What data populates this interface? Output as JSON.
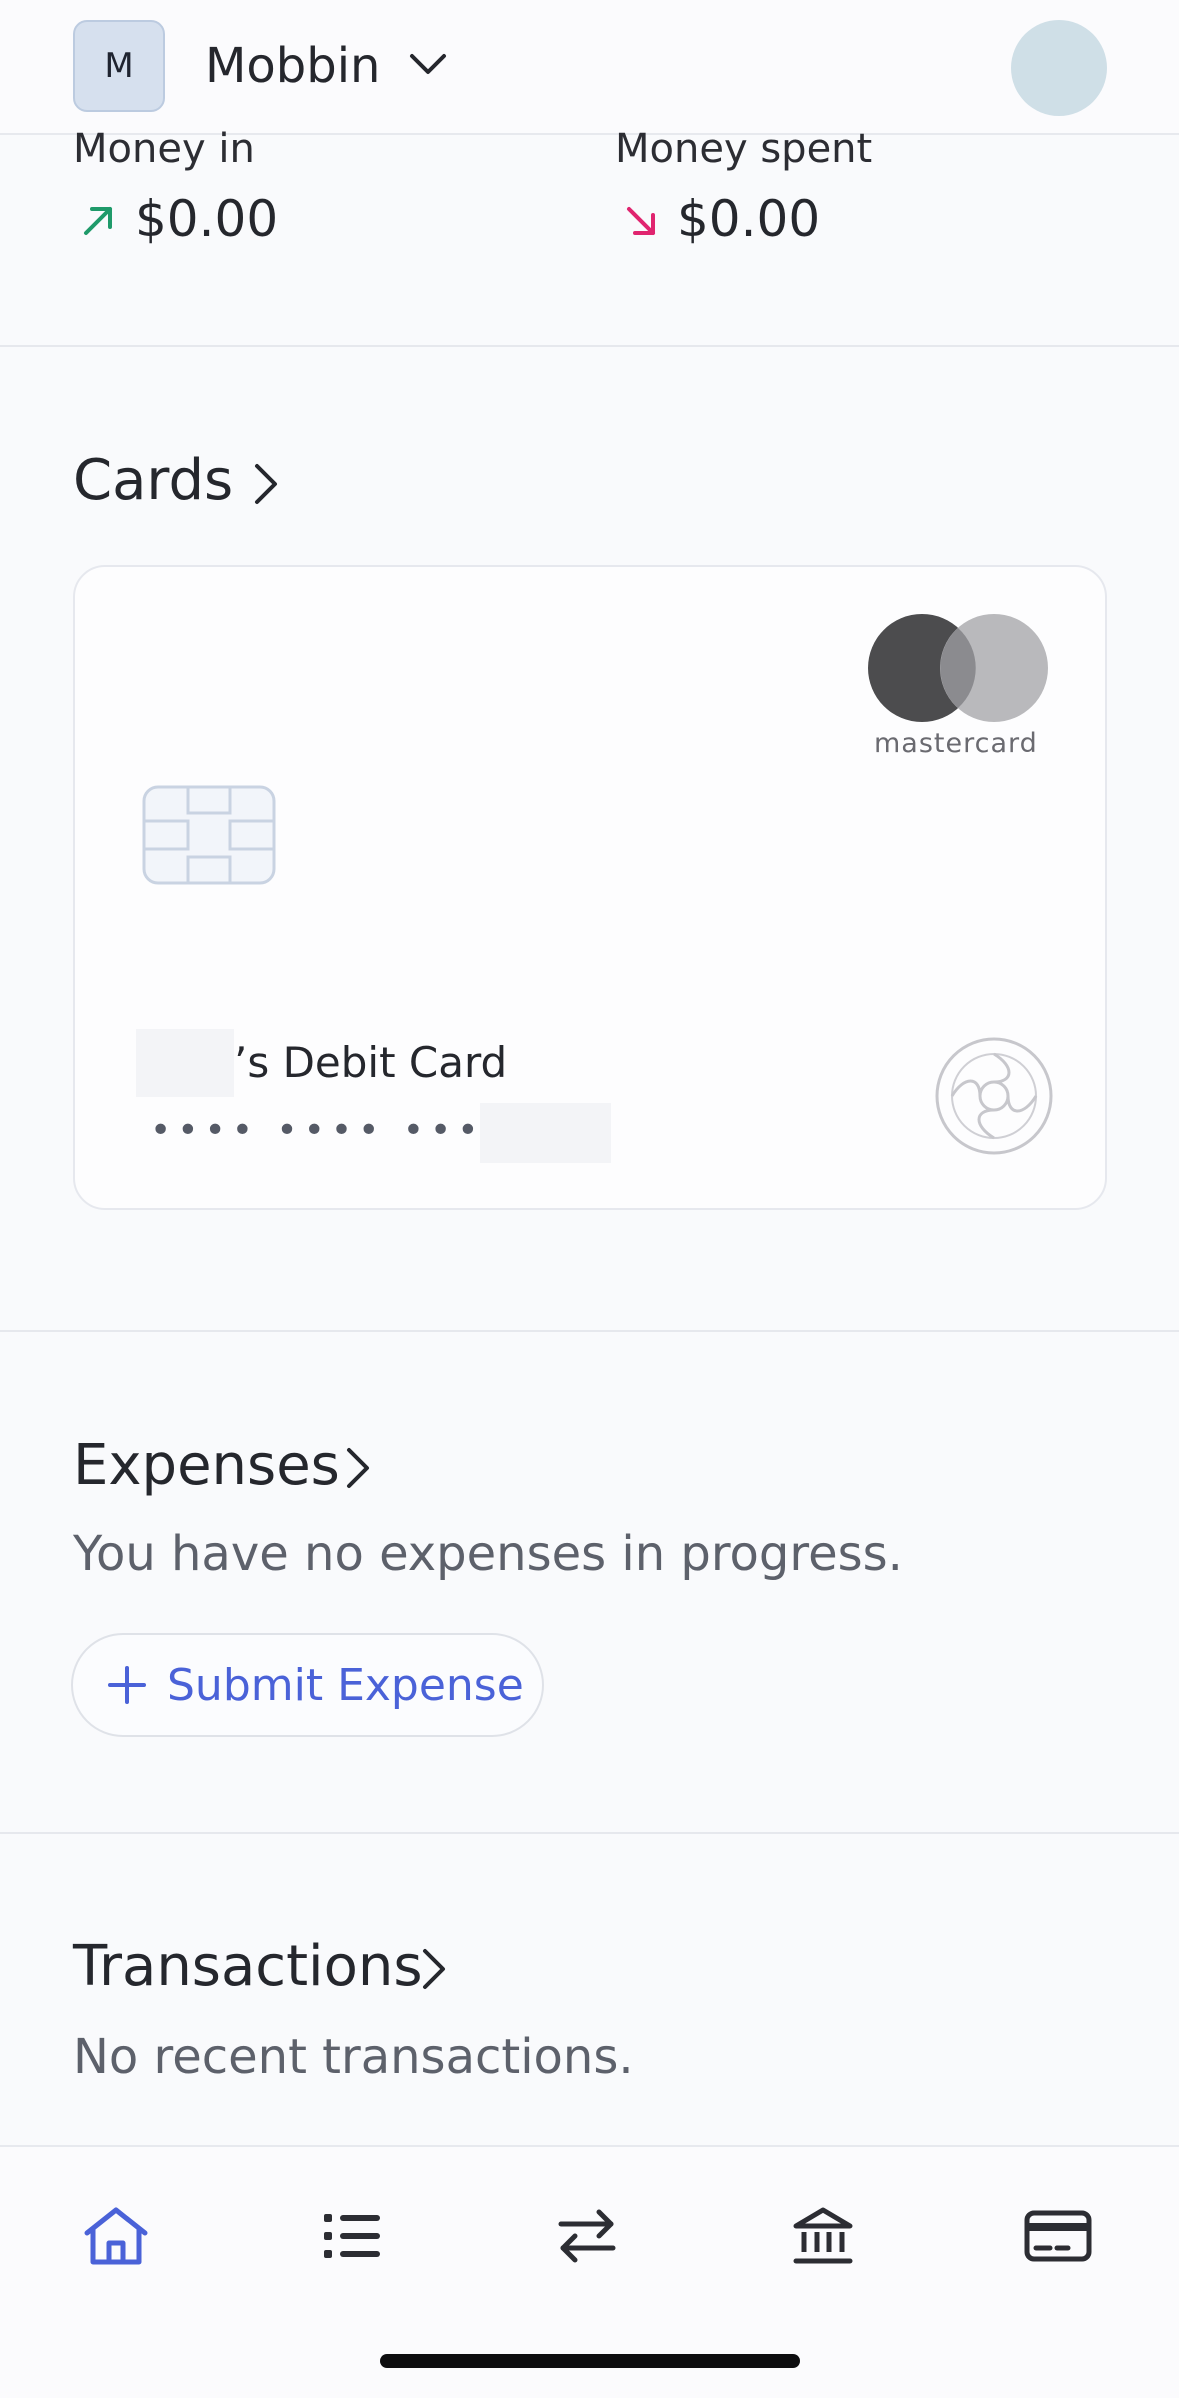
{
  "header": {
    "org_initial": "M",
    "org_name": "Mobbin"
  },
  "summary": {
    "money_in_label": "Money in",
    "money_in_value": "$0.00",
    "money_spent_label": "Money spent",
    "money_spent_value": "$0.00"
  },
  "cards": {
    "title": "Cards",
    "card": {
      "name_suffix": "’s Debit Card",
      "number_masked": "•••• •••• ••••",
      "brand": "mastercard"
    }
  },
  "expenses": {
    "title": "Expenses",
    "empty_text": "You have no expenses in progress.",
    "submit_label": "Submit Expense"
  },
  "transactions": {
    "title": "Transactions",
    "empty_text": "No recent transactions."
  },
  "tabs": [
    {
      "icon": "home-icon",
      "active": true
    },
    {
      "icon": "list-icon",
      "active": false
    },
    {
      "icon": "transfer-icon",
      "active": false
    },
    {
      "icon": "bank-icon",
      "active": false
    },
    {
      "icon": "card-icon",
      "active": false
    }
  ],
  "colors": {
    "accent": "#4a62d8",
    "money_in_arrow": "#1f9a6a",
    "money_out_arrow": "#e0246f"
  }
}
